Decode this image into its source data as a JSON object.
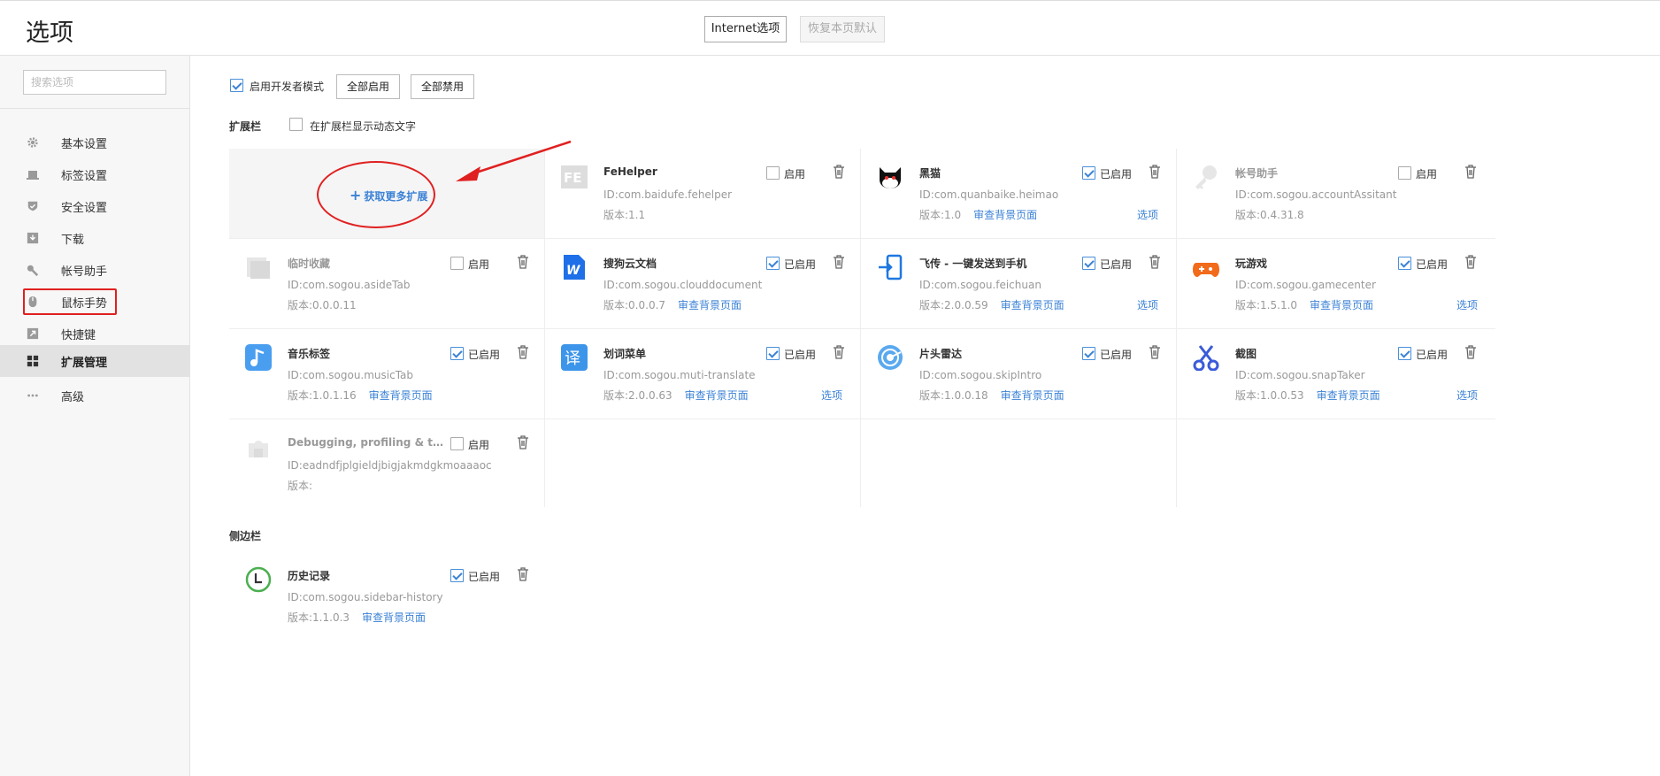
{
  "header": {
    "title": "选项",
    "internet_options": "Internet选项",
    "restore_defaults": "恢复本页默认"
  },
  "sidebar": {
    "search_placeholder": "搜索选项",
    "items": [
      {
        "label": "基本设置",
        "icon": "gear-icon"
      },
      {
        "label": "标签设置",
        "icon": "tab-icon"
      },
      {
        "label": "安全设置",
        "icon": "shield-icon"
      },
      {
        "label": "下载",
        "icon": "download-icon"
      },
      {
        "label": "帐号助手",
        "icon": "key-icon"
      },
      {
        "label": "鼠标手势",
        "icon": "mouse-icon"
      },
      {
        "label": "快捷键",
        "icon": "shortcut-icon"
      },
      {
        "label": "扩展管理",
        "icon": "grid-icon",
        "active": true
      },
      {
        "label": "高级",
        "icon": "more-icon"
      }
    ]
  },
  "toolbar": {
    "dev_mode_label": "启用开发者模式",
    "dev_mode_checked": true,
    "enable_all": "全部启用",
    "disable_all": "全部禁用"
  },
  "extension_bar": {
    "title": "扩展栏",
    "dynamic_text_label": "在扩展栏显示动态文字",
    "dynamic_text_checked": false,
    "get_more_label": "获取更多扩展",
    "get_more_plus": "+"
  },
  "extensions": [
    {
      "name": "FeHelper",
      "id": "ID:com.baidufe.fehelper",
      "version": "版本:1.1",
      "bg_link": "",
      "enabled": false,
      "state_label": "启用",
      "options": "",
      "icon": "fehelper-icon"
    },
    {
      "name": "黑猫",
      "id": "ID:com.quanbaike.heimao",
      "version": "版本:1.0",
      "bg_link": "审查背景页面",
      "enabled": true,
      "state_label": "已启用",
      "options": "选项",
      "icon": "black-cat-icon"
    },
    {
      "name": "帐号助手",
      "id": "ID:com.sogou.accountAssitant",
      "version": "版本:0.4.31.8",
      "bg_link": "",
      "enabled": false,
      "state_label": "启用",
      "options": "",
      "icon": "key-icon"
    },
    {
      "name": "临时收藏",
      "id": "ID:com.sogou.asideTab",
      "version": "版本:0.0.0.11",
      "bg_link": "",
      "enabled": false,
      "state_label": "启用",
      "options": "",
      "icon": "temp-collect-icon"
    },
    {
      "name": "搜狗云文档",
      "id": "ID:com.sogou.clouddocument",
      "version": "版本:0.0.0.7",
      "bg_link": "审查背景页面",
      "enabled": true,
      "state_label": "已启用",
      "options": "",
      "icon": "word-doc-icon"
    },
    {
      "name": "飞传 - 一键发送到手机",
      "id": "ID:com.sogou.feichuan",
      "version": "版本:2.0.0.59",
      "bg_link": "审查背景页面",
      "enabled": true,
      "state_label": "已启用",
      "options": "选项",
      "icon": "send-to-phone-icon"
    },
    {
      "name": "玩游戏",
      "id": "ID:com.sogou.gamecenter",
      "version": "版本:1.5.1.0",
      "bg_link": "审查背景页面",
      "enabled": true,
      "state_label": "已启用",
      "options": "选项",
      "icon": "gamepad-icon"
    },
    {
      "name": "音乐标签",
      "id": "ID:com.sogou.musicTab",
      "version": "版本:1.0.1.16",
      "bg_link": "审查背景页面",
      "enabled": true,
      "state_label": "已启用",
      "options": "",
      "icon": "music-note-icon"
    },
    {
      "name": "划词菜单",
      "id": "ID:com.sogou.muti-translate",
      "version": "版本:2.0.0.63",
      "bg_link": "审查背景页面",
      "enabled": true,
      "state_label": "已启用",
      "options": "选项",
      "icon": "translate-icon"
    },
    {
      "name": "片头雷达",
      "id": "ID:com.sogou.skipIntro",
      "version": "版本:1.0.0.18",
      "bg_link": "审查背景页面",
      "enabled": true,
      "state_label": "已启用",
      "options": "",
      "icon": "radar-icon"
    },
    {
      "name": "截图",
      "id": "ID:com.sogou.snapTaker",
      "version": "版本:1.0.0.53",
      "bg_link": "审查背景页面",
      "enabled": true,
      "state_label": "已启用",
      "options": "选项",
      "icon": "scissors-icon"
    },
    {
      "name": "Debugging, profiling & tracing",
      "id": "ID:eadndfjplgieldjbigjakmdgkmoaaaoc",
      "version": "版本:",
      "bg_link": "",
      "enabled": false,
      "state_label": "启用",
      "options": "",
      "icon": "puzzle-icon"
    }
  ],
  "sidebar_section": {
    "title": "侧边栏",
    "items": [
      {
        "name": "历史记录",
        "id": "ID:com.sogou.sidebar-history",
        "version": "版本:1.1.0.3",
        "bg_link": "审查背景页面",
        "enabled": true,
        "state_label": "已启用",
        "icon": "clock-icon"
      }
    ]
  },
  "colors": {
    "accent": "#3b82d6",
    "annotation_red": "#e02020"
  }
}
